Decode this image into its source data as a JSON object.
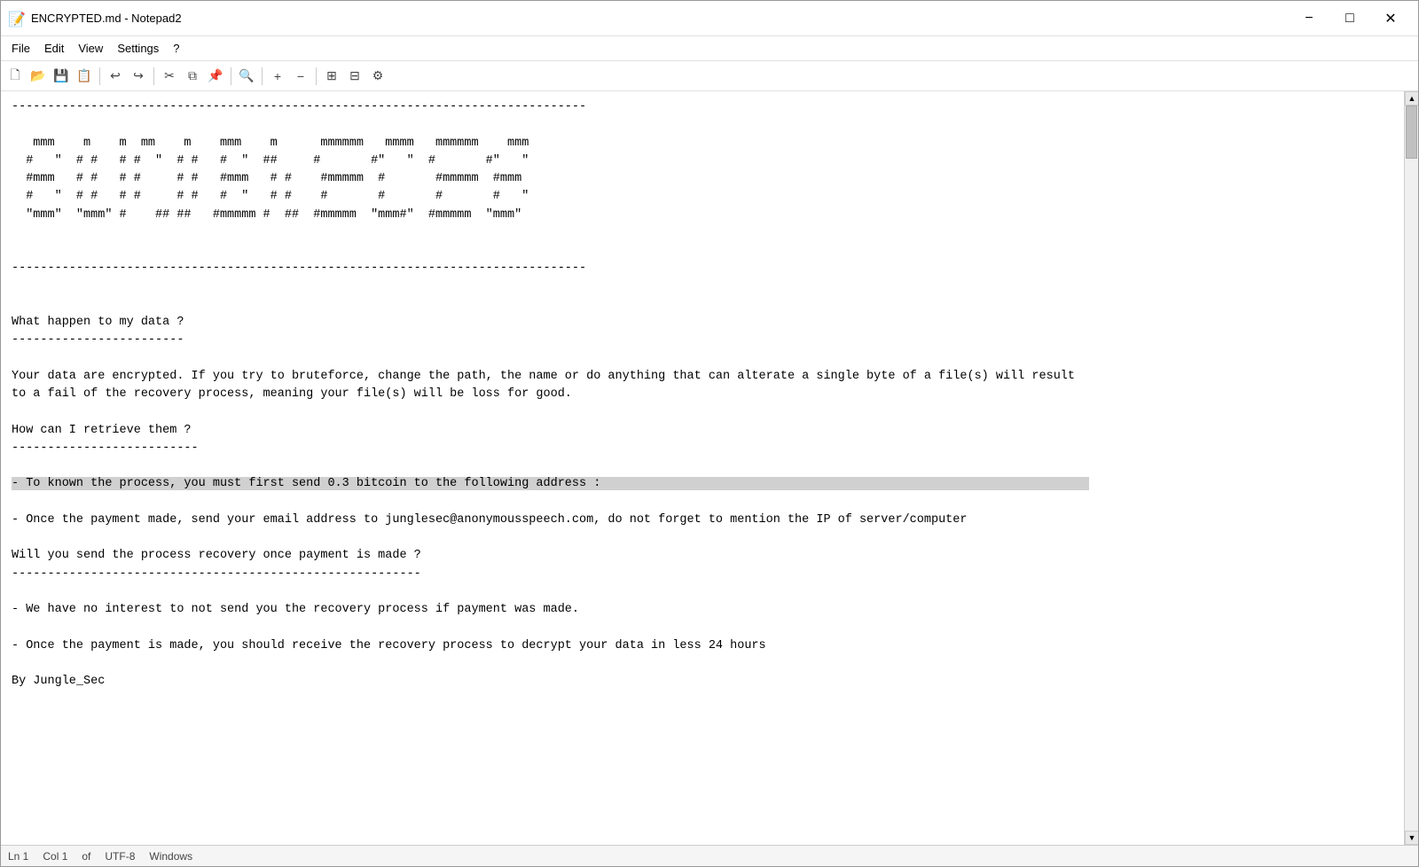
{
  "window": {
    "title": "ENCRYPTED.md - Notepad2",
    "icon": "📝"
  },
  "title_controls": {
    "minimize": "─",
    "maximize": "□",
    "close": "✕"
  },
  "menu": {
    "items": [
      "File",
      "Edit",
      "View",
      "Settings",
      "?"
    ]
  },
  "toolbar": {
    "buttons": [
      {
        "name": "new",
        "icon": "🗋"
      },
      {
        "name": "open",
        "icon": "📂"
      },
      {
        "name": "save",
        "icon": "💾"
      },
      {
        "name": "save-copy",
        "icon": "📋"
      },
      {
        "name": "undo",
        "icon": "↩"
      },
      {
        "name": "redo",
        "icon": "↪"
      },
      {
        "name": "cut",
        "icon": "✂"
      },
      {
        "name": "copy",
        "icon": "⧉"
      },
      {
        "name": "paste",
        "icon": "📌"
      },
      {
        "name": "find",
        "icon": "🔍"
      },
      {
        "name": "zoom-in",
        "icon": "+"
      },
      {
        "name": "zoom-out",
        "icon": "-"
      },
      {
        "name": "view1",
        "icon": "⊞"
      },
      {
        "name": "view2",
        "icon": "⊟"
      },
      {
        "name": "settings",
        "icon": "⚙"
      }
    ]
  },
  "content": {
    "lines": [
      "--------------------------------------------------------------------------------",
      "",
      "   mmm    m    m  mm    m    mmm    m      mmmmmm   mmmm   mmmmmm    mmm  ",
      "  #   \"  # #   # #  \"  # #   #  \"  ##     #       #\"   \"  #       #\"   \" ",
      "  #mmm   # #   # #     # #   #mmm   # #    #mmmmm  #       #mmmmm  #mmm  ",
      "  #   \"  # #   # #     # #   #  \"   # #    #       #       #       #   \" ",
      "  \"mmm\"  \"mmm\"  #    ## ##   #mmmmm #  ##  #mmmmm  \"mmm#\"  #mmmmm  \"mmm\" ",
      "",
      "",
      "--------------------------------------------------------------------------------",
      "",
      "",
      "What happen to my data ?",
      "------------------------",
      "",
      "Your data are encrypted. If you try to bruteforce, change the path, the name or do anything that can alterate a single byte of a file(s) will result",
      "to a fail of the recovery process, meaning your file(s) will be loss for good.",
      "",
      "How can I retrieve them ?",
      "--------------------------",
      "",
      "- To known the process, you must first send 0.3 bitcoin to the following address :",
      "",
      "- Once the payment made, send your email address to junglesec@anonymousspeech.com, do not forget to mention the IP of server/computer",
      "",
      "Will you send the process recovery once payment is made ?",
      "---------------------------------------------------------",
      "",
      "- We have no interest to not send you the recovery process if payment was made.",
      "",
      "- Once the payment is made, you should receive the recovery process to decrypt your data in less 24 hours",
      "",
      "By Jungle_Sec"
    ],
    "highlight_line": 21
  },
  "status": {
    "line": "Ln 1",
    "col": "Col 1",
    "of_label": "of",
    "encoding": "UTF-8",
    "line_endings": "Windows"
  }
}
